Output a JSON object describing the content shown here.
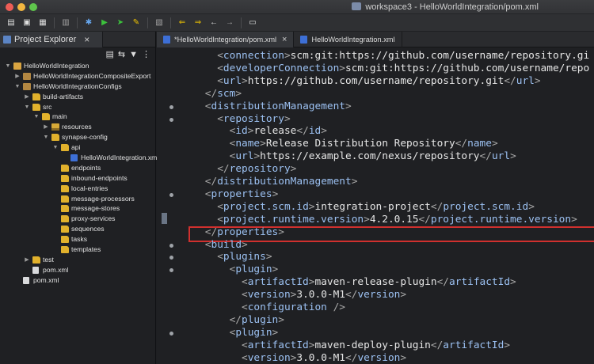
{
  "window": {
    "title": "workspace3 - HelloWorldIntegration/pom.xml"
  },
  "toolbar": {
    "icons": [
      "new-icon",
      "save-icon",
      "save-all-icon",
      "properties-icon",
      "debug-icon",
      "run-icon",
      "external-tools-icon",
      "edit-icon",
      "next-annotation-icon",
      "previous-annotation-icon",
      "back-icon",
      "forward-icon",
      "console-icon"
    ]
  },
  "explorer": {
    "tab_label": "Project Explorer",
    "tree": [
      {
        "label": "HelloWorldIntegration",
        "depth": 0,
        "expanded": true,
        "icon": "project"
      },
      {
        "label": "HelloWorldIntegrationCompositeExport",
        "depth": 1,
        "expanded": false,
        "icon": "pkg"
      },
      {
        "label": "HelloWorldIntegrationConfigs",
        "depth": 1,
        "expanded": true,
        "icon": "pkg"
      },
      {
        "label": "build-artifacts",
        "depth": 2,
        "expanded": false,
        "icon": "folder"
      },
      {
        "label": "src",
        "depth": 2,
        "expanded": true,
        "icon": "folder"
      },
      {
        "label": "main",
        "depth": 3,
        "expanded": true,
        "icon": "folder"
      },
      {
        "label": "resources",
        "depth": 4,
        "expanded": false,
        "icon": "srcfolder"
      },
      {
        "label": "synapse-config",
        "depth": 4,
        "expanded": true,
        "icon": "folder"
      },
      {
        "label": "api",
        "depth": 5,
        "expanded": true,
        "icon": "folder"
      },
      {
        "label": "HelloWorldIntegration.xml",
        "depth": 6,
        "expanded": null,
        "icon": "xml"
      },
      {
        "label": "endpoints",
        "depth": 5,
        "expanded": null,
        "icon": "folder"
      },
      {
        "label": "inbound-endpoints",
        "depth": 5,
        "expanded": null,
        "icon": "folder"
      },
      {
        "label": "local-entries",
        "depth": 5,
        "expanded": null,
        "icon": "folder"
      },
      {
        "label": "message-processors",
        "depth": 5,
        "expanded": null,
        "icon": "folder"
      },
      {
        "label": "message-stores",
        "depth": 5,
        "expanded": null,
        "icon": "folder"
      },
      {
        "label": "proxy-services",
        "depth": 5,
        "expanded": null,
        "icon": "folder"
      },
      {
        "label": "sequences",
        "depth": 5,
        "expanded": null,
        "icon": "folder"
      },
      {
        "label": "tasks",
        "depth": 5,
        "expanded": null,
        "icon": "folder"
      },
      {
        "label": "templates",
        "depth": 5,
        "expanded": null,
        "icon": "folder"
      },
      {
        "label": "test",
        "depth": 2,
        "expanded": false,
        "icon": "folder"
      },
      {
        "label": "pom.xml",
        "depth": 2,
        "expanded": null,
        "icon": "file"
      },
      {
        "label": "pom.xml",
        "depth": 1,
        "expanded": null,
        "icon": "file"
      }
    ]
  },
  "editor": {
    "tabs": [
      {
        "label": "*HelloWorldIntegration/pom.xml",
        "active": true
      },
      {
        "label": "HelloWorldIntegration.xml",
        "active": false
      }
    ],
    "highlighted_line": 9,
    "lines": [
      {
        "indent": 3,
        "kind": "element",
        "tag": "connection",
        "text": "scm:git:https://github.com/username/repository.gi",
        "close": false,
        "fold": false
      },
      {
        "indent": 3,
        "kind": "element",
        "tag": "developerConnection",
        "text": "scm:git:https://github.com/username/repo",
        "close": false,
        "fold": false
      },
      {
        "indent": 3,
        "kind": "element",
        "tag": "url",
        "text": "https://github.com/username/repository.git",
        "close": true,
        "fold": false
      },
      {
        "indent": 2,
        "kind": "close",
        "tag": "scm",
        "fold": false
      },
      {
        "indent": 2,
        "kind": "open",
        "tag": "distributionManagement",
        "fold": true
      },
      {
        "indent": 3,
        "kind": "open",
        "tag": "repository",
        "fold": true
      },
      {
        "indent": 4,
        "kind": "element",
        "tag": "id",
        "text": "release",
        "close": true,
        "fold": false
      },
      {
        "indent": 4,
        "kind": "element",
        "tag": "name",
        "text": "Release Distribution Repository",
        "close": true,
        "fold": false
      },
      {
        "indent": 4,
        "kind": "element",
        "tag": "url",
        "text": "https://example.com/nexus/repository",
        "close": true,
        "fold": false
      },
      {
        "indent": 3,
        "kind": "close",
        "tag": "repository",
        "fold": false
      },
      {
        "indent": 2,
        "kind": "close",
        "tag": "distributionManagement",
        "fold": false
      },
      {
        "indent": 2,
        "kind": "open",
        "tag": "properties",
        "fold": true
      },
      {
        "indent": 3,
        "kind": "element",
        "tag": "project.scm.id",
        "text": "integration-project",
        "close": true,
        "fold": false
      },
      {
        "indent": 3,
        "kind": "element",
        "tag": "project.runtime.version",
        "text": "4.2.0.15",
        "close": true,
        "fold": false
      },
      {
        "indent": 2,
        "kind": "close",
        "tag": "properties",
        "fold": false
      },
      {
        "indent": 2,
        "kind": "open",
        "tag": "build",
        "fold": true
      },
      {
        "indent": 3,
        "kind": "open",
        "tag": "plugins",
        "fold": true
      },
      {
        "indent": 4,
        "kind": "open",
        "tag": "plugin",
        "fold": true
      },
      {
        "indent": 5,
        "kind": "element",
        "tag": "artifactId",
        "text": "maven-release-plugin",
        "close": true,
        "fold": false
      },
      {
        "indent": 5,
        "kind": "element",
        "tag": "version",
        "text": "3.0.0-M1",
        "close": true,
        "fold": false
      },
      {
        "indent": 5,
        "kind": "selfclose",
        "tag": "configuration",
        "fold": false
      },
      {
        "indent": 4,
        "kind": "close",
        "tag": "plugin",
        "fold": false
      },
      {
        "indent": 4,
        "kind": "open",
        "tag": "plugin",
        "fold": true
      },
      {
        "indent": 5,
        "kind": "element",
        "tag": "artifactId",
        "text": "maven-deploy-plugin",
        "close": true,
        "fold": false
      },
      {
        "indent": 5,
        "kind": "element",
        "tag": "version",
        "text": "3.0.0-M1",
        "close": true,
        "fold": false
      }
    ]
  },
  "colors": {
    "tag": "#9cc1f2",
    "bracket": "#a9a9a9",
    "text": "#e6e6e6",
    "highlight_border": "#d0302e"
  }
}
